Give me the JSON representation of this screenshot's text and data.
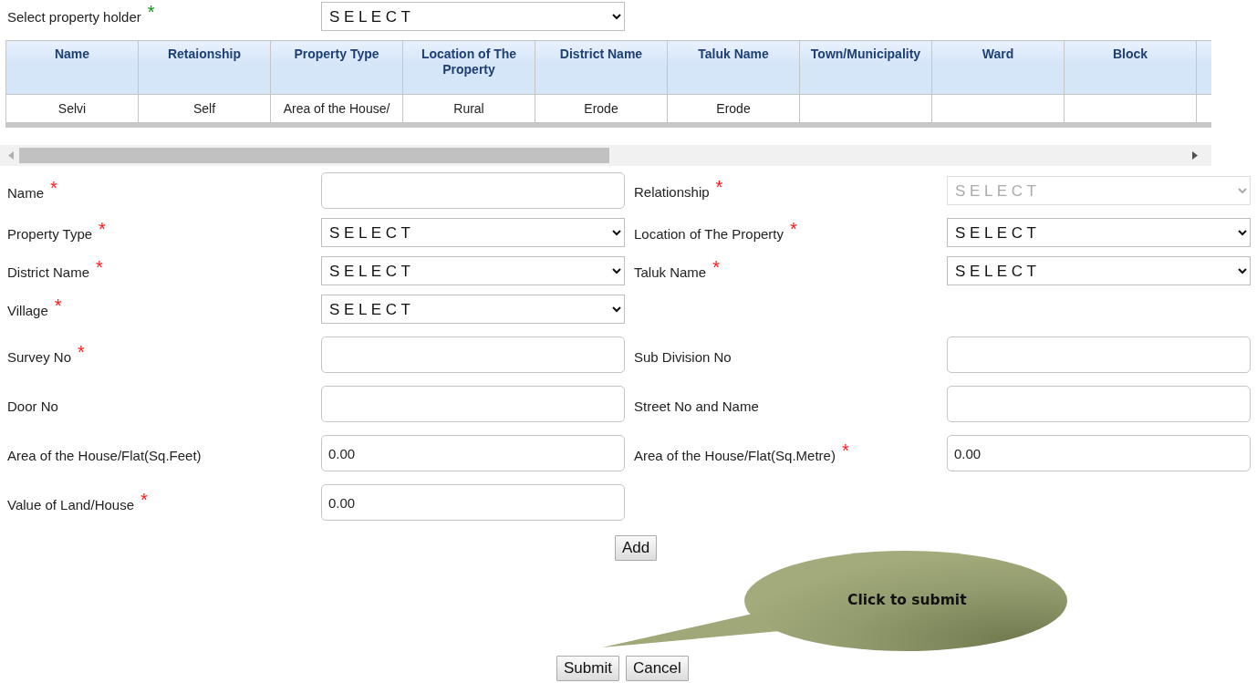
{
  "holder_select": {
    "label": "Select property holder",
    "asterisk": "*",
    "value": "S E L E C T"
  },
  "table": {
    "columns": [
      "Name",
      "Retaionship",
      "Property Type",
      "Location of The Property",
      "District Name",
      "Taluk Name",
      "Town/Municipality",
      "Ward",
      "Block"
    ],
    "rows": [
      [
        "Selvi",
        "Self",
        "Area of the House/",
        "Rural",
        "Erode",
        "Erode"
      ]
    ]
  },
  "form_rows": [
    {
      "left": {
        "label": "Name",
        "asterisk": "*",
        "kind": "text"
      },
      "right": {
        "label": "Relationship",
        "asterisk": "*",
        "kind": "select",
        "value": "S E L E C T",
        "disabled": true
      }
    },
    {
      "left": {
        "label": "Property Type",
        "asterisk": "*",
        "kind": "select",
        "value": "S E L E C T",
        "disabled": false
      },
      "right": {
        "label": "Location of The Property",
        "asterisk": "*",
        "kind": "select",
        "value": "S E L E C T",
        "disabled": false
      }
    },
    {
      "left": {
        "label": "District Name",
        "asterisk": "*",
        "kind": "select",
        "value": "S E L E C T",
        "disabled": false
      },
      "right": {
        "label": "Taluk Name",
        "asterisk": "*",
        "kind": "select",
        "value": "S E L E C T",
        "disabled": false
      }
    },
    {
      "left": {
        "label": "Village",
        "asterisk": "*",
        "kind": "select",
        "value": "S E L E C T",
        "disabled": false
      }
    },
    {
      "left": {
        "label": "Survey No",
        "asterisk": "*",
        "kind": "text"
      },
      "right": {
        "label": "Sub Division No",
        "kind": "text"
      }
    },
    {
      "left": {
        "label": "Door No",
        "kind": "text"
      },
      "right": {
        "label": "Street No and Name",
        "kind": "text"
      }
    },
    {
      "left": {
        "label": "Area of the House/Flat(Sq.Feet)",
        "kind": "text",
        "value": "0.00"
      },
      "right": {
        "label": "Area of the House/Flat(Sq.Metre)",
        "asterisk": "*",
        "kind": "text",
        "value": "0.00"
      }
    },
    {
      "left": {
        "label": "Value of Land/House",
        "asterisk": "*",
        "kind": "text",
        "value": "0.00"
      }
    }
  ],
  "add_button": "Add",
  "callout": {
    "text": "Click to submit"
  },
  "buttons": [
    "Submit",
    "Cancel"
  ]
}
